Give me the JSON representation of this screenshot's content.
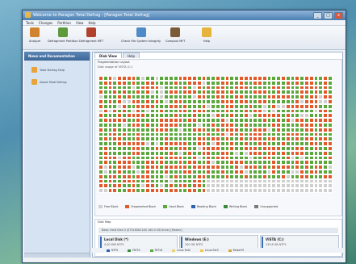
{
  "window": {
    "title": "Welcome to Paragon Total Defrag - [Paragon Total Defrag]",
    "buttons": [
      "_",
      "□",
      "x"
    ]
  },
  "menu": [
    "Tools",
    "Changes",
    "Partition",
    "View",
    "Help"
  ],
  "toolbar": [
    {
      "label": "Analyze",
      "icon": "analyze-icon",
      "color": "#d2832f"
    },
    {
      "label": "Defragment Partition",
      "icon": "defrag-partition-icon",
      "color": "#5c9a3c"
    },
    {
      "label": "Defragment MFT",
      "icon": "defrag-mft-icon",
      "color": "#b0412d"
    },
    {
      "label": "Check File System Integrity",
      "icon": "check-fs-icon",
      "color": "#4f8bc6"
    },
    {
      "label": "Compact MFT",
      "icon": "compact-mft-icon",
      "color": "#7b5a3a"
    },
    {
      "label": "Help",
      "icon": "help-icon",
      "color": "#e6b43c"
    }
  ],
  "sidebar": {
    "header": "News and Documentation",
    "items": [
      {
        "label": "Total Defrag Help",
        "icon": "help-book-icon"
      },
      {
        "label": "About Total Defrag",
        "icon": "about-icon"
      }
    ]
  },
  "tabs": [
    {
      "label": "Disk View",
      "active": true
    },
    {
      "label": "Help",
      "active": false
    }
  ],
  "fragmentation": {
    "title": "Fragmentation Layout",
    "subtitle": "Disk usage of VISTA (C:)"
  },
  "legend": [
    {
      "label": "Free Block",
      "color": "#cfcfcf"
    },
    {
      "label": "Fragmented Block",
      "color": "#e25a2c"
    },
    {
      "label": "Used Block",
      "color": "#5aa83c"
    },
    {
      "label": "Reading Block",
      "color": "#2f5fb0"
    },
    {
      "label": "Writing Block",
      "color": "#3a8a3a"
    },
    {
      "label": "Unsupported",
      "color": "#7a7a7a"
    }
  ],
  "disk_map": {
    "title": "Disk Map",
    "disk_label": "Basic Hard Disk 0 (ST3160811AS 160.0 GB Drive) [Master]",
    "partitions": [
      {
        "name": "Local Disk (*)",
        "size": "4.00 MiB NTFS"
      },
      {
        "name": "Windows (E:)",
        "size": "200 GB NTFS"
      },
      {
        "name": "VISTA (C:)",
        "size": "135.8 GB NTFS"
      }
    ],
    "fs_legend": [
      {
        "label": "NTFS",
        "color": "#2f5fb0"
      },
      {
        "label": "FAT32",
        "color": "#3a8a3a"
      },
      {
        "label": "FAT16",
        "color": "#5aa83c"
      },
      {
        "label": "Linux Ext2",
        "color": "#e8d27a"
      },
      {
        "label": "Linux Ext3",
        "color": "#f0c84a"
      },
      {
        "label": "ReiserFS",
        "color": "#d9a83a"
      }
    ]
  },
  "colors": {
    "used": "#5aa83c",
    "fragmented": "#e25a2c",
    "free": "#cfcfcf"
  }
}
